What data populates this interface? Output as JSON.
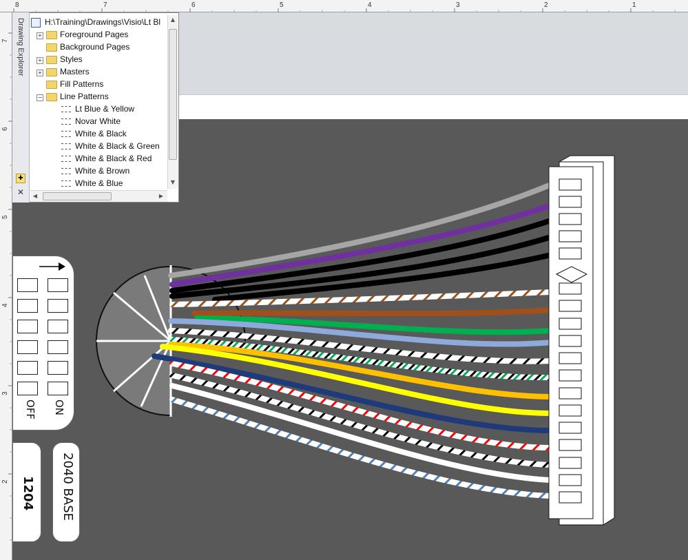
{
  "rulers": {
    "top_labels": [
      "8",
      "7",
      "6",
      "5",
      "4",
      "3",
      "2",
      "1"
    ],
    "left_labels": [
      "7",
      "6",
      "5",
      "4",
      "3",
      "2"
    ]
  },
  "drawing_explorer": {
    "title": "Drawing Explorer",
    "root": "H:\\Training\\Drawings\\Visio\\Lt Bl",
    "folders": [
      {
        "label": "Foreground Pages",
        "expander": "+"
      },
      {
        "label": "Background Pages",
        "expander": ""
      },
      {
        "label": "Styles",
        "expander": "+"
      },
      {
        "label": "Masters",
        "expander": "+"
      },
      {
        "label": "Fill Patterns",
        "expander": ""
      },
      {
        "label": "Line Patterns",
        "expander": "−"
      }
    ],
    "line_patterns": [
      "Lt Blue & Yellow",
      "Novar White",
      "White & Black",
      "White & Black & Green",
      "White & Black & Red",
      "White & Brown",
      "White & Blue"
    ],
    "pin_icon": "pushpin-icon",
    "close_icon": "close-icon"
  },
  "switch_panel": {
    "off_label": "OFF",
    "on_label": "ON"
  },
  "badges": {
    "left": "1204",
    "right": "2040 BASE"
  },
  "colors": {
    "drawing_bg": "#595959",
    "canvas_bg": "#d8dbe0",
    "wire_gray": "#a6a6a6",
    "wire_purple": "#7030a0",
    "wire_black": "#000000",
    "wire_brown": "#a0501a",
    "wire_green": "#00b050",
    "wire_lightblue": "#8eaadb",
    "wire_orange": "#ffc000",
    "wire_yellow": "#ffff00",
    "wire_navy": "#1f3a7a",
    "wire_white": "#ffffff"
  }
}
